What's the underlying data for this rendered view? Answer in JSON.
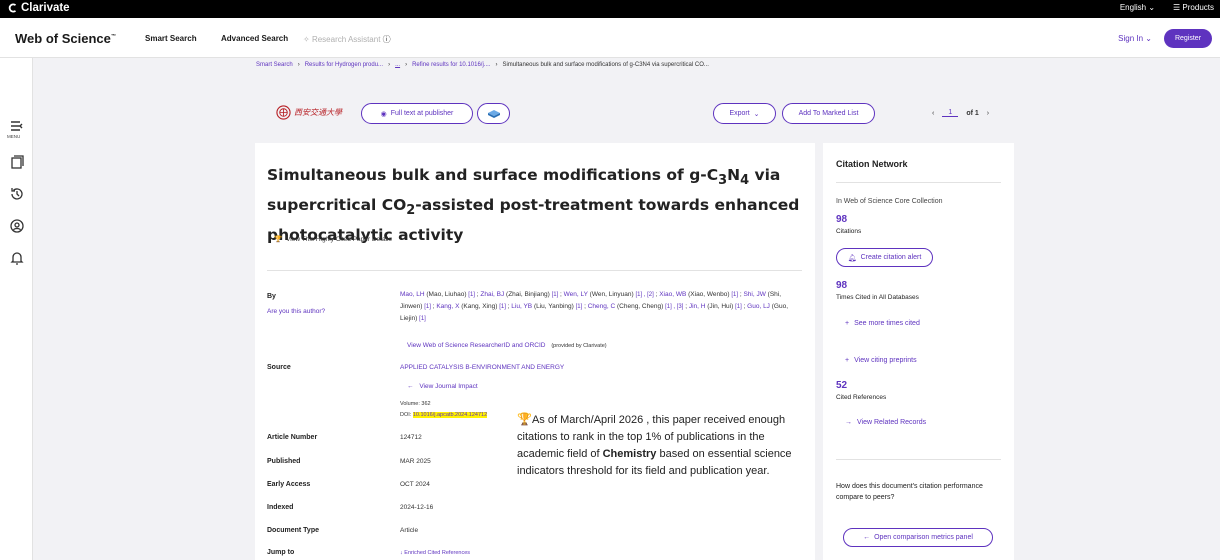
{
  "topbar": {
    "brand": "Clarivate",
    "language": "English",
    "products": "Products"
  },
  "header": {
    "logo": "Web of Science",
    "nav": [
      "Smart Search",
      "Advanced Search",
      "Research Assistant"
    ],
    "signin": "Sign In",
    "register": "Register"
  },
  "leftrail": {
    "menu": "MENU"
  },
  "breadcrumb": {
    "items": [
      "Smart Search",
      "Results for Hydrogen produ...",
      "...",
      "Refine results for 10.1016/j....",
      "Simultaneous bulk and surface modifications of g-C3N4 via supercritical CO..."
    ],
    "sep": "›"
  },
  "actions": {
    "uni_name": "西安交通大學",
    "full_text": "Full text at publisher",
    "export": "Export",
    "add_marked": "Add To Marked List",
    "page": "1",
    "of": "of 1"
  },
  "record": {
    "title_part1": "Simultaneous bulk and surface modifications of g-C",
    "title_sub1": "3",
    "title_part2": "N",
    "title_sub2": "4",
    "title_part3": " via supercritical CO",
    "title_sub3": "2",
    "title_part4": "-assisted post-treatment towards enhanced photocatalytic activity",
    "highly_cited": "View This Highly Cited Paper Details",
    "by_label": "By",
    "are_you": "Are you this author?",
    "authors": [
      {
        "short": "Mao, LH",
        "full": " (Mao, Liuhao) ",
        "aff": "[1]"
      },
      {
        "short": "Zhai, BJ",
        "full": " (Zhai, Binjiang) ",
        "aff": "[1]"
      },
      {
        "short": "Wen, LY",
        "full": " (Wen, Linyuan) ",
        "aff": "[1] , [2]"
      },
      {
        "short": "Xiao, WB",
        "full": " (Xiao, Wenbo) ",
        "aff": "[1]"
      },
      {
        "short": "Shi, JW",
        "full": " (Shi, Jinwen) ",
        "aff": "[1]"
      },
      {
        "short": "Kang, X",
        "full": " (Kang, Xing) ",
        "aff": "[1]"
      },
      {
        "short": "Liu, YB",
        "full": " (Liu, Yanbing) ",
        "aff": "[1]"
      },
      {
        "short": "Cheng, C",
        "full": " (Cheng, Cheng) ",
        "aff": "[1] , [3]"
      },
      {
        "short": "Jin, H",
        "full": " (Jin, Hui) ",
        "aff": "[1]"
      },
      {
        "short": "Guo, LJ",
        "full": " (Guo, Liejin) ",
        "aff": "[1]"
      }
    ],
    "researcher_id": "View Web of Science ResearcherID and ORCID",
    "provided_by": "(provided by Clarivate)",
    "source_label": "Source",
    "source_val": "APPLIED CATALYSIS B-ENVIRONMENT AND ENERGY",
    "journal_impact": "View Journal Impact",
    "volume": "Volume: 362",
    "doi_label": "DOI:",
    "doi": "10.1016/j.apcatb.2024.124712",
    "article_number_label": "Article Number",
    "article_number": "124712",
    "published_label": "Published",
    "published": "MAR 2025",
    "early_access_label": "Early Access",
    "early_access": "OCT 2024",
    "indexed_label": "Indexed",
    "indexed": "2024-12-16",
    "doctype_label": "Document Type",
    "doctype": "Article",
    "jump_label": "Jump to",
    "jump_val": "Enriched Cited References"
  },
  "tooltip": {
    "text1": "As of March/April 2026 , this paper received enough citations to rank in the top 1% of publications in the academic field of ",
    "field": "Chemistry",
    "text2": " based on essential science indicators threshold for its field and publication year."
  },
  "citation_network": {
    "heading": "Citation Network",
    "core_collection": "In Web of Science Core Collection",
    "citations_num": "98",
    "citations_label": "Citations",
    "create_alert": "Create citation alert",
    "all_db_num": "98",
    "all_db_label": "Times Cited in All Databases",
    "see_more": "See more times cited",
    "preprints": "View citing preprints",
    "cited_refs_num": "52",
    "cited_refs_label": "Cited References",
    "related": "View Related Records",
    "compare_q": "How does this document's citation performance compare to peers?",
    "compare_btn": "Open comparison metrics panel"
  }
}
